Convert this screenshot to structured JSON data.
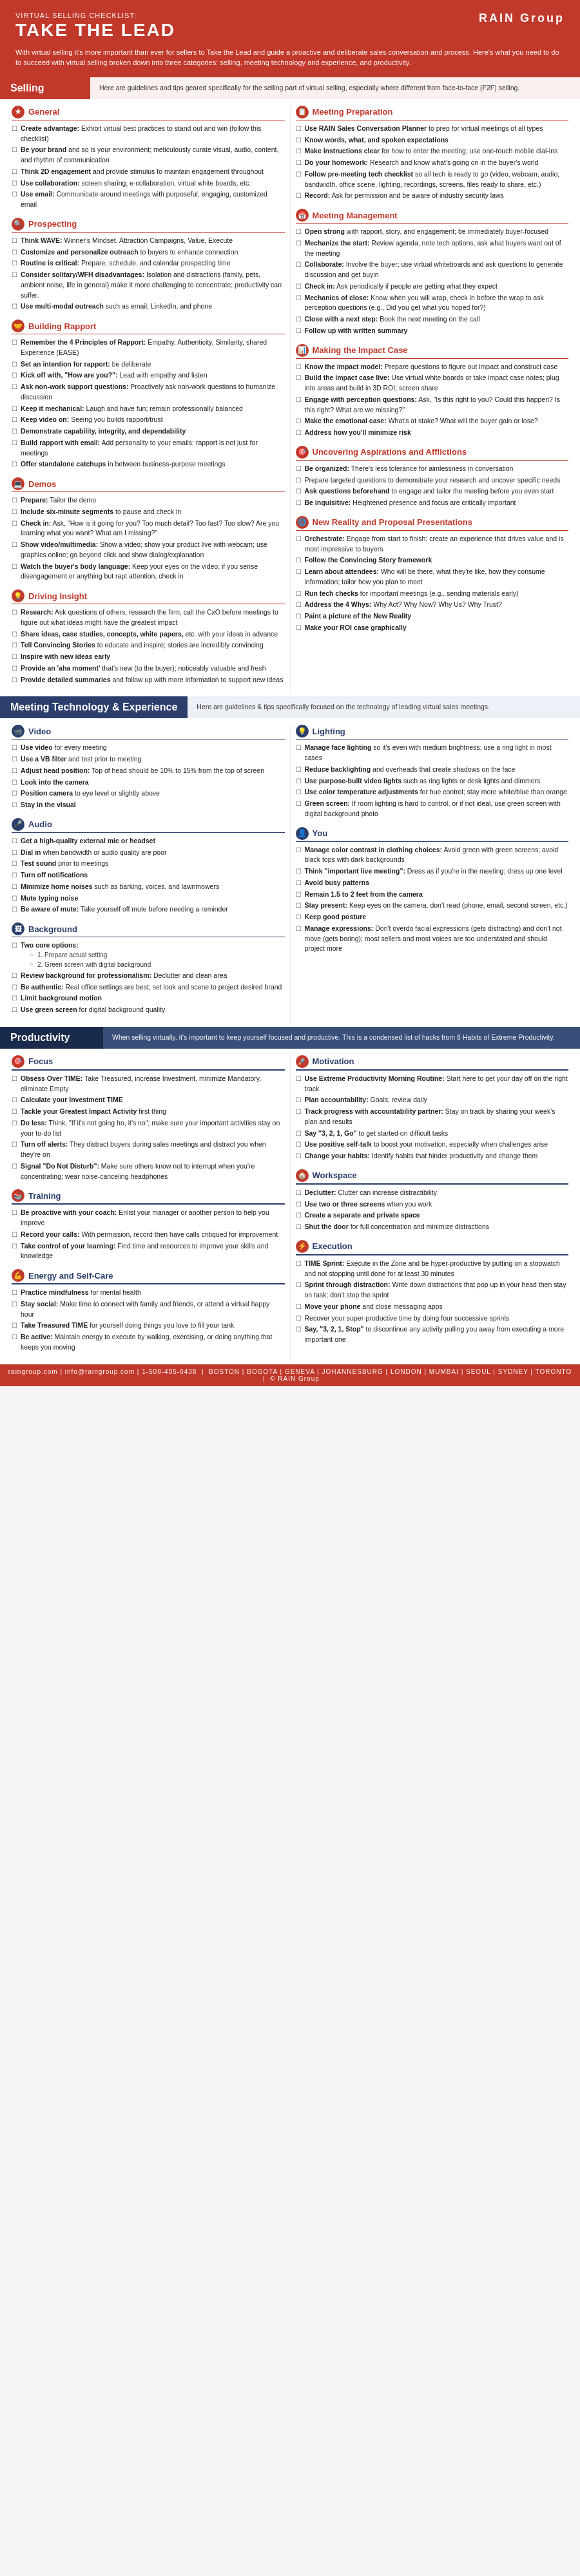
{
  "header": {
    "subtitle": "Virtual Selling Checklist:",
    "title": "TAKE THE LEAD",
    "logo": "RAIN Group",
    "logo_sub": "BOSTON | BOGOTA | GENEVA | JOHANNESBURG | LONDON | MUMBAI | SEOUL | SYDNEY | TORONTO",
    "description": "With virtual selling it's more important than ever for sellers to Take the Lead and guide a proactive and deliberate sales conversation and process. Here's what you need to do to succeed with virtual selling broken down into three categories: selling, meeting technology and experience, and productivity."
  },
  "selling_section": {
    "label": "Selling",
    "desc": "Here are guidelines and tips geared specifically for the selling part of virtual selling, especially where different from face-to-face (F2F) selling."
  },
  "meeting_tech_section": {
    "label": "Meeting Technology & Experience",
    "desc": "Here are guidelines & tips specifically focused on the technology of leading virtual sales meetings."
  },
  "productivity_section": {
    "label": "Productivity",
    "desc": "When selling virtually, it's important to keep yourself focused and productive. This is a condensed list of hacks from 8 Habits of Extreme Productivity."
  },
  "general": {
    "title": "General",
    "icon": "★",
    "items": [
      {
        "text": "Create advantage: Exhibit virtual best practices to stand out and win (follow this checklist)"
      },
      {
        "text": "Be your brand and so is your environment; meticulously curate visual, audio, content, and rhythm of communication"
      },
      {
        "text": "Think 2D engagement and provide stimulus to maintain engagement throughout"
      },
      {
        "text": "Use collaboration: screen sharing, e-collaboration, virtual white boards, etc."
      },
      {
        "text": "Use email: Communicate around meetings with purposeful, engaging, customized email"
      }
    ]
  },
  "prospecting": {
    "title": "Prospecting",
    "icon": "🔍",
    "items": [
      {
        "text": "Think WAVE: Winner's Mindset, Attraction Campaigns, Value, Execute"
      },
      {
        "text": "Customize and personalize outreach to buyers to enhance connection"
      },
      {
        "text": "Routine is critical: Prepare, schedule, and calendar prospecting time"
      },
      {
        "text": "Consider solitary/WFH disadvantages: Isolation and distractions (family, pets, ambient noise, life in general) make it more challenging to concentrate; productivity can suffer."
      },
      {
        "text": "Use multi-modal outreach such as email, LinkedIn, and phone"
      }
    ]
  },
  "building_rapport": {
    "title": "Building Rapport",
    "icon": "🤝",
    "items": [
      {
        "text": "Remember the 4 Principles of Rapport: Empathy, Authenticity, Similarity, shared Experience (EASE)"
      },
      {
        "text": "Set an intention for rapport: be deliberate"
      },
      {
        "text": "Kick off with, \"How are you?\": Lead with empathy and listen"
      },
      {
        "text": "Ask non-work support questions: Proactively ask non-work questions to humanize discussion"
      },
      {
        "text": "Keep it mechanical: Laugh and have fun; remain professionally balanced"
      },
      {
        "text": "Keep video on: Seeing you builds rapport/trust"
      },
      {
        "text": "Demonstrate capability, integrity, and dependability"
      },
      {
        "text": "Build rapport with email: Add personality to your emails; rapport is not just for meetings"
      },
      {
        "text": "Offer standalone catchups in between business-purpose meetings"
      }
    ]
  },
  "demos": {
    "title": "Demos",
    "icon": "💻",
    "items": [
      {
        "text": "Prepare: Tailor the demo"
      },
      {
        "text": "Include six-minute segments to pause and check in"
      },
      {
        "text": "Check in: Ask, \"How is it going for you? Too much detail? Too fast? Too slow? Are you learning what you want? What am I missing?\""
      },
      {
        "text": "Show video/multimedia: Show a video; show your product live with webcam; use graphics online; go beyond click and show dialog/explanation"
      },
      {
        "text": "Watch the buyer's body language: Keep your eyes on the video; if you sense disengagement or anything but rapt attention, check in"
      }
    ]
  },
  "driving_insight": {
    "title": "Driving Insight",
    "icon": "💡",
    "items": [
      {
        "text": "Research: Ask questions of others, research the firm, call the CxO before meetings to figure out what ideas might have the greatest impact"
      },
      {
        "text": "Share ideas, case studies, concepts, white papers, etc. with your ideas in advance"
      },
      {
        "text": "Tell Convincing Stories to educate and inspire; stories are incredibly convincing"
      },
      {
        "text": "Inspire with new ideas early"
      },
      {
        "text": "Provide an 'aha moment' that's new (to the buyer); noticeably valuable and fresh"
      },
      {
        "text": "Provide detailed summaries and follow up with more information to support new ideas"
      }
    ]
  },
  "meeting_prep": {
    "title": "Meeting Preparation",
    "icon": "📋",
    "items": [
      {
        "text": "Use RAIN Sales Conversation Planner to prep for virtual meetings of all types"
      },
      {
        "text": "Know words, what, and spoken expectations"
      },
      {
        "text": "Make instructions clear for how to enter the meeting; use one-touch mobile dial-ins"
      },
      {
        "text": "Do your homework: Research and know what's going on in the buyer's world"
      },
      {
        "text": "Follow pre-meeting tech checklist so all tech is ready to go (video, webcam, audio, bandwidth, office scene, lighting, recordings, screens, files ready to share, etc.)"
      },
      {
        "text": "Record: Ask for permission and be aware of industry security laws"
      }
    ]
  },
  "meeting_management": {
    "title": "Meeting Management",
    "icon": "📅",
    "items": [
      {
        "text": "Open strong with rapport, story, and engagement; be immediately buyer-focused"
      },
      {
        "text": "Mechanize the start: Review agenda, note tech options, ask what buyers want out of the meeting"
      },
      {
        "text": "Collaborate: Involve the buyer; use virtual whiteboards and ask questions to generate discussion and get buyin"
      },
      {
        "text": "Check in: Ask periodically if people are getting what they expect"
      },
      {
        "text": "Mechanics of close: Know when you will wrap, check in before the wrap to ask perception questions (e.g., Did you get what you hoped for?)"
      },
      {
        "text": "Close with a next step: Book the next meeting on the call"
      },
      {
        "text": "Follow up with written summary"
      }
    ]
  },
  "making_impact": {
    "title": "Making the Impact Case",
    "icon": "📊",
    "items": [
      {
        "text": "Know the impact model: Prepare questions to figure out impact and construct case"
      },
      {
        "text": "Build the impact case live: Use virtual white boards or take impact case notes; plug into areas and build in 3D ROI; screen share"
      },
      {
        "text": "Engage with perception questions: Ask, \"Is this right to you? Could this happen? Is this right? What are we missing?\""
      },
      {
        "text": "Make the emotional case: What's at stake? What will the buyer gain or lose?"
      },
      {
        "text": "Address how you'll minimize risk"
      }
    ]
  },
  "uncovering": {
    "title": "Uncovering Aspirations and Afflictions",
    "icon": "🎯",
    "items": [
      {
        "text": "Be organized: There's less tolerance for aimlessness in conversation"
      },
      {
        "text": "Prepare targeted questions to demonstrate your research and uncover specific needs"
      },
      {
        "text": "Ask questions beforehand to engage and tailor the meeting before you even start"
      },
      {
        "text": "Be inquisitive: Heightened presence and focus are critically important"
      }
    ]
  },
  "new_reality": {
    "title": "New Reality and Proposal Presentations",
    "icon": "🌐",
    "items": [
      {
        "text": "Orchestrate: Engage from start to finish; create an experience that drives value and is most impressive to buyers"
      },
      {
        "text": "Follow the Convincing Story framework"
      },
      {
        "text": "Learn about attendees: Who will be there, what they're like, how they consume information; tailor how you plan to meet"
      },
      {
        "text": "Run tech checks for important meetings (e.g., sending materials early)"
      },
      {
        "text": "Address the 4 Whys: Why Act? Why Now? Why Us? Why Trust?"
      },
      {
        "text": "Paint a picture of the New Reality"
      },
      {
        "text": "Make your ROI case graphically"
      }
    ]
  },
  "video": {
    "title": "Video",
    "icon": "📹",
    "items": [
      {
        "text": "Use video for every meeting"
      },
      {
        "text": "Use a VB filter and test prior to meeting"
      },
      {
        "text": "Adjust head position: Top of head should be 10% to 15% from the top of screen"
      },
      {
        "text": "Look into the camera"
      },
      {
        "text": "Position camera to eye level or slightly above"
      },
      {
        "text": "Stay in the visual"
      }
    ]
  },
  "audio": {
    "title": "Audio",
    "icon": "🎤",
    "items": [
      {
        "text": "Get a high-quality external mic or headset"
      },
      {
        "text": "Dial in when bandwidth or audio quality are poor"
      },
      {
        "text": "Test sound prior to meetings"
      },
      {
        "text": "Turn off notifications"
      },
      {
        "text": "Minimize home noises such as barking, voices, and lawnmowers"
      },
      {
        "text": "Mute typing noise"
      },
      {
        "text": "Be aware of mute: Take yourself off mute before needing a reminder"
      }
    ]
  },
  "background": {
    "title": "Background",
    "icon": "🖼",
    "items": [
      {
        "text": "Two core options:"
      },
      {
        "text": "Review background for professionalism: Declutter and clean area"
      },
      {
        "text": "Be authentic: Real office settings are best; set look and scene to project desired brand"
      },
      {
        "text": "Limit background motion"
      },
      {
        "text": "Use green screen for digital background quality"
      }
    ],
    "sub": [
      "1. Prepare actual setting",
      "2. Green screen with digital background"
    ]
  },
  "lighting": {
    "title": "Lighting",
    "icon": "💡",
    "items": [
      {
        "text": "Manage face lighting so it's even with medium brightness; use a ring light in most cases"
      },
      {
        "text": "Reduce backlighting and overheads that create shadows on the face"
      },
      {
        "text": "Use purpose-built video lights such as ring lights or desk lights and dimmers"
      },
      {
        "text": "Use color temperature adjustments for hue control; stay more white/blue than orange"
      },
      {
        "text": "Green screen: If room lighting is hard to control, or if not ideal, use green screen with digital background photo"
      }
    ]
  },
  "you": {
    "title": "You",
    "icon": "👤",
    "items": [
      {
        "text": "Manage color contrast in clothing choices: Avoid green with green screens; avoid black tops with dark backgrounds"
      },
      {
        "text": "Think \"important live meeting\": Dress as if you're in the meeting; dress up one level"
      },
      {
        "text": "Avoid busy patterns"
      },
      {
        "text": "Remain 1.5 to 2 feet from the camera"
      },
      {
        "text": "Stay present: Keep eyes on the camera, don't read (phone, email, second screen, etc.)"
      },
      {
        "text": "Keep good posture"
      },
      {
        "text": "Manage expressions: Don't overdo facial expressions (gets distracting) and don't not move (gets boring); most sellers and most voices are too understated and should project more"
      }
    ]
  },
  "focus": {
    "title": "Focus",
    "icon": "🎯",
    "items": [
      {
        "text": "Obsess Over TIME: Take Treasured, increase Investment, minimize Mandatory, eliminate Empty"
      },
      {
        "text": "Calculate your Investment TIME"
      },
      {
        "text": "Tackle your Greatest Impact Activity first thing"
      },
      {
        "text": "Do less: Think, \"If it's not going ho, it's no\"; make sure your important activities stay on your to-do list"
      },
      {
        "text": "Turn off alerts: They distract buyers during sales meetings and distract you when they're on"
      },
      {
        "text": "Signal \"Do Not Disturb\": Make sure others know not to interrupt when you're concentrating; wear noise-canceling headphones"
      }
    ]
  },
  "training": {
    "title": "Training",
    "icon": "📚",
    "items": [
      {
        "text": "Be proactive with your coach: Enlist your manager or another person to help you improve"
      },
      {
        "text": "Record your calls: With permission, record then have calls critiqued for improvement"
      },
      {
        "text": "Take control of your learning: Find time and resources to improve your skills and knowledge"
      }
    ]
  },
  "energy_selfcare": {
    "title": "Energy and Self-Care",
    "icon": "💪",
    "items": [
      {
        "text": "Practice mindfulness for mental health"
      },
      {
        "text": "Stay social: Make time to connect with family and friends, or attend a virtual happy hour"
      },
      {
        "text": "Take Treasured TIME for yourself doing things you love to fill your tank"
      },
      {
        "text": "Be active: Maintain energy to execute by walking, exercising, or doing anything that keeps you moving"
      }
    ]
  },
  "motivation": {
    "title": "Motivation",
    "icon": "🚀",
    "items": [
      {
        "text": "Use Extreme Productivity Morning Routine: Start here to get your day off on the right track"
      },
      {
        "text": "Plan accountability: Goals; review daily"
      },
      {
        "text": "Track progress with accountability partner: Stay on track by sharing your week's plan and results"
      },
      {
        "text": "Say \"3, 2, 1, Go\" to get started on difficult tasks"
      },
      {
        "text": "Use positive self-talk to boost your motivation, especially when challenges arise"
      },
      {
        "text": "Change your habits: Identify habits that hinder productivity and change them"
      }
    ]
  },
  "workspace": {
    "title": "Workspace",
    "icon": "🏠",
    "items": [
      {
        "text": "Declutter: Clutter can increase distractibility"
      },
      {
        "text": "Use two or three screens when you work"
      },
      {
        "text": "Create a separate and private space"
      },
      {
        "text": "Shut the door for full concentration and minimize distractions"
      }
    ]
  },
  "execution": {
    "title": "Execution",
    "icon": "⚡",
    "items": [
      {
        "text": "TIME Sprint: Execute in the Zone and be hyper-productive by putting on a stopwatch and not stopping until done for at least 30 minutes"
      },
      {
        "text": "Sprint through distraction: Write down distractions that pop up in your head then stay on task; don't stop the sprint"
      },
      {
        "text": "Move your phone and close messaging apps"
      },
      {
        "text": "Recover your super-productive time by doing four successive sprints"
      },
      {
        "text": "Say, \"3, 2, 1, Stop\" to discontinue any activity pulling you away from executing a more important one"
      }
    ]
  },
  "footer": {
    "email": "raingroup.com | info@raingroup.com | 1-508-405-0438",
    "offices": "BOSTON | BOGOTA | GENEVA | JOHANNESBURG | LONDON | MUMBAI | SEOUL | SYDNEY | TORONTO",
    "copyright": "© RAIN Group"
  }
}
